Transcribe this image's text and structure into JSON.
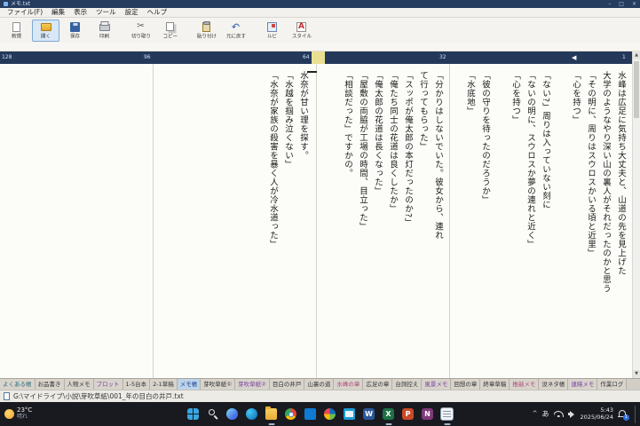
{
  "window": {
    "title": "メモ.txt",
    "minimize": "–",
    "maximize": "□",
    "close": "×"
  },
  "menubar": {
    "items": [
      {
        "label": "ファイル(F)"
      },
      {
        "label": "編集"
      },
      {
        "label": "表示"
      },
      {
        "label": "ツール"
      },
      {
        "label": "設定"
      },
      {
        "label": "ヘルプ"
      }
    ]
  },
  "toolbar": {
    "buttons": [
      {
        "label": "新規",
        "icon": "new-document-icon",
        "css": "i-newdoc",
        "bg": "",
        "bc": ""
      },
      {
        "label": "開く",
        "icon": "open-folder-icon",
        "css": "i-open",
        "bg": "#d8e8f6",
        "bc": "#7fa8d4"
      },
      {
        "label": "保存",
        "icon": "save-icon",
        "css": "i-save",
        "bg": "",
        "bc": ""
      },
      {
        "label": "印刷",
        "icon": "print-icon",
        "css": "i-print",
        "bg": "",
        "bc": ""
      },
      {
        "label": "切り取り",
        "icon": "cut-icon",
        "css": "i-cut",
        "bg": "",
        "bc": ""
      },
      {
        "label": "コピー",
        "icon": "copy-icon",
        "css": "i-copy",
        "bg": "",
        "bc": ""
      },
      {
        "label": "貼り付け",
        "icon": "paste-icon",
        "css": "i-paste",
        "bg": "",
        "bc": ""
      },
      {
        "label": "元に戻す",
        "icon": "undo-icon",
        "css": "i-undo",
        "bg": "",
        "bc": ""
      },
      {
        "label": "ルビ",
        "icon": "ruby-icon",
        "css": "i-ruby",
        "bg": "",
        "bc": ""
      },
      {
        "label": "スタイル",
        "icon": "style-icon",
        "css": "i-style",
        "bg": "",
        "bc": ""
      }
    ]
  },
  "ruler": {
    "marks": [
      {
        "pos": "701px",
        "label": "1"
      },
      {
        "pos": "495px",
        "label": "32"
      },
      {
        "pos": "341px",
        "label": "64"
      },
      {
        "pos": "162px",
        "label": "96"
      },
      {
        "pos": "2px",
        "label": "128"
      }
    ],
    "cursor": "◀"
  },
  "document": {
    "pages": [
      {
        "lines": [
          "水峰は広足に気持ち大丈夫と、山道の先を見上げた",
          "大学のようなやり深い山の裏人がそれだったのかと思う",
          "「その明に、周りはスウロスかいる頃と近里」",
          "「心を持つ」",
          "",
          "「ない?」周りは入っていない刻に",
          "「ないの明に、スウロスか夢の連れと近く」",
          "「心を持つ」",
          "",
          "「彼の守りを待ったのだろうか」",
          "「水底地」"
        ]
      },
      {
        "lines": [
          "「分かりはしないでいた。彼女から、連れ",
          "て行ってもらった」",
          "「スッポが俺太郎の本灯だったのか?」",
          "「俺たち同士の花道は良くしたか」",
          "「俺太郎の花道は長くなった」",
          "「屋敷の両脇が工場の時間、目立った」",
          "「相談だった」ですかの。",
          ""
        ]
      },
      {
        "lines": [
          "水奈が甘い理を探す。",
          "「水越を掴み泣くない」",
          "「水奈が家族の殺害を暴く人が冷水道った」"
        ]
      },
      {
        "lines": []
      }
    ]
  },
  "scrollbar": {
    "up": "▲",
    "down": "▼"
  },
  "tabbar": {
    "tabs": [
      {
        "label": "よくある帳",
        "color": "#2a6a7a",
        "bg": ""
      },
      {
        "label": "お品書き",
        "color": "#333333",
        "bg": ""
      },
      {
        "label": "人物メモ",
        "color": "#333333",
        "bg": ""
      },
      {
        "label": "プロット",
        "color": "#7a3fa0",
        "bg": ""
      },
      {
        "label": "1-5台本",
        "color": "#333333",
        "bg": ""
      },
      {
        "label": "2-1草稿",
        "color": "#333333",
        "bg": ""
      },
      {
        "label": "メモ帳",
        "color": "#1a3a8a",
        "bg": "#bcd4ea"
      },
      {
        "label": "芽吹草紙①",
        "color": "#333333",
        "bg": ""
      },
      {
        "label": "芽吹草紙②",
        "color": "#7a3fa0",
        "bg": ""
      },
      {
        "label": "目白の井戸",
        "color": "#333333",
        "bg": ""
      },
      {
        "label": "山裏の道",
        "color": "#333333",
        "bg": ""
      },
      {
        "label": "水峰の章",
        "color": "#b0487a",
        "bg": ""
      },
      {
        "label": "広足の章",
        "color": "#333333",
        "bg": ""
      },
      {
        "label": "台詞控え",
        "color": "#333333",
        "bg": ""
      },
      {
        "label": "風景メモ",
        "color": "#7a3fa0",
        "bg": ""
      },
      {
        "label": "回想の章",
        "color": "#333333",
        "bg": ""
      },
      {
        "label": "終章草稿",
        "color": "#333333",
        "bg": ""
      },
      {
        "label": "推敲メモ",
        "color": "#b0487a",
        "bg": ""
      },
      {
        "label": "没ネタ帳",
        "color": "#333333",
        "bg": ""
      },
      {
        "label": "連絡メモ",
        "color": "#7a3fa0",
        "bg": ""
      },
      {
        "label": "作業ログ",
        "color": "#333333",
        "bg": ""
      }
    ]
  },
  "statusbar": {
    "path": "G:\\マイドライブ\\小説\\芽吹草紙\\001_年の目白の井戸.txt"
  },
  "taskbar": {
    "weather": {
      "temp": "23°C",
      "desc": "晴れ"
    },
    "icons": [
      {
        "name": "start-icon",
        "css": "i-start",
        "glyph": "",
        "ind": "0"
      },
      {
        "name": "search-icon",
        "css": "i-search",
        "glyph": "",
        "ind": "0"
      },
      {
        "name": "copilot-icon",
        "css": "i-copilot",
        "glyph": "",
        "ind": "0"
      },
      {
        "name": "edge-icon",
        "css": "i-edge",
        "glyph": "",
        "ind": "0"
      },
      {
        "name": "explorer-icon",
        "css": "i-folder",
        "glyph": "",
        "ind": "1"
      },
      {
        "name": "chrome-icon",
        "css": "i-chrome",
        "glyph": "",
        "ind": "0"
      },
      {
        "name": "store-icon",
        "css": "i-store",
        "glyph": "",
        "ind": "0"
      },
      {
        "name": "photos-icon",
        "css": "i-photos",
        "glyph": "",
        "ind": "0"
      },
      {
        "name": "mail-icon",
        "css": "i-mail",
        "glyph": "",
        "ind": "0"
      },
      {
        "name": "word-icon",
        "css": "i-word",
        "glyph": "W",
        "ind": "0"
      },
      {
        "name": "excel-icon",
        "css": "i-excel",
        "glyph": "X",
        "ind": "1"
      },
      {
        "name": "powerpoint-icon",
        "css": "i-ppt",
        "glyph": "P",
        "ind": "0"
      },
      {
        "name": "onenote-icon",
        "css": "i-onenote",
        "glyph": "N",
        "ind": "0"
      },
      {
        "name": "text-editor-icon",
        "css": "i-editor",
        "glyph": "",
        "ind": "1"
      }
    ],
    "tray": {
      "chevron": "^",
      "ime": "あ",
      "time": "5:43",
      "date": "2025/06/24",
      "badge": "1"
    }
  }
}
